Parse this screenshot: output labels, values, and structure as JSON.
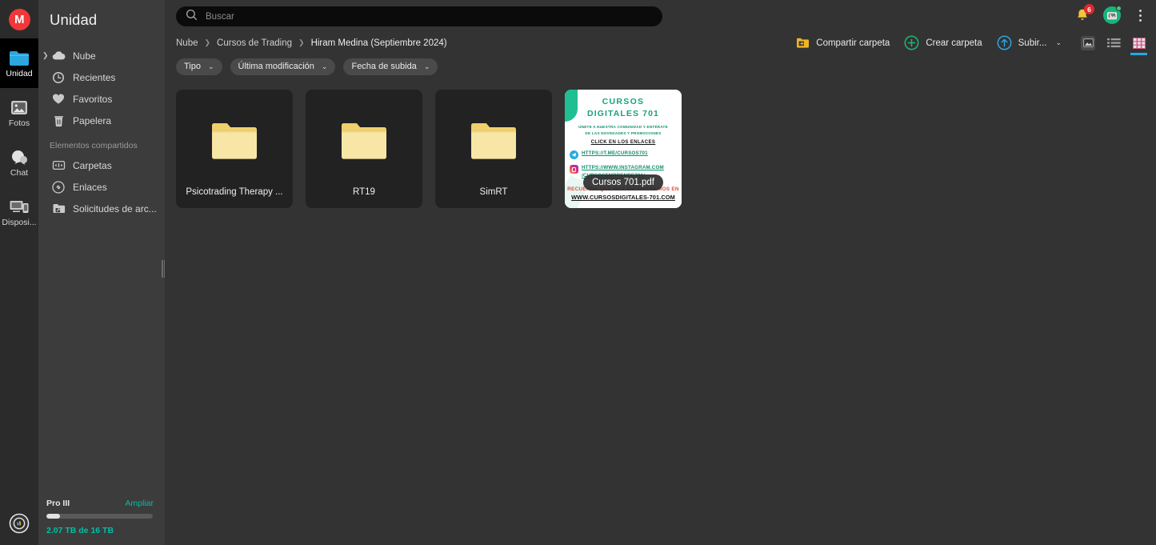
{
  "app": {
    "logo_text": "M"
  },
  "rail": {
    "items": [
      {
        "label": "Unidad",
        "icon": "drive-folder-icon",
        "active": true
      },
      {
        "label": "Fotos",
        "icon": "photos-icon",
        "active": false
      },
      {
        "label": "Chat",
        "icon": "chat-bubble-icon",
        "active": false
      },
      {
        "label": "Disposi...",
        "icon": "devices-icon",
        "active": false
      }
    ],
    "bottom_icon": "transfers-status-icon"
  },
  "sidebar": {
    "title": "Unidad",
    "nav": [
      {
        "label": "Nube",
        "icon": "cloud-icon",
        "expandable": true
      },
      {
        "label": "Recientes",
        "icon": "clock-icon",
        "expandable": false
      },
      {
        "label": "Favoritos",
        "icon": "heart-icon",
        "expandable": false
      },
      {
        "label": "Papelera",
        "icon": "trash-icon",
        "expandable": false
      }
    ],
    "shared_section": "Elementos compartidos",
    "shared": [
      {
        "label": "Carpetas",
        "icon": "shared-folders-icon"
      },
      {
        "label": "Enlaces",
        "icon": "link-icon"
      },
      {
        "label": "Solicitudes de arc...",
        "icon": "file-request-icon"
      }
    ],
    "storage": {
      "plan": "Pro III",
      "upgrade_label": "Ampliar",
      "used_text": "2.07 TB de 16 TB",
      "percent": 13,
      "accent_color": "#00bfa5"
    }
  },
  "topbar": {
    "search": {
      "placeholder": "Buscar",
      "value": "",
      "icon": "search-icon"
    },
    "notifications": {
      "icon": "bell-icon",
      "count": "6",
      "badge_color": "#e3272d"
    },
    "avatar": {
      "icon": "user-avatar-icon",
      "status": "online"
    },
    "menu_icon": "kebab-menu-icon"
  },
  "breadcrumb": {
    "items": [
      "Nube",
      "Cursos de Trading",
      "Hiram Medina (Septiembre 2024)"
    ],
    "separator": "❯"
  },
  "actions": {
    "share_folder": {
      "label": "Compartir carpeta",
      "icon": "share-folder-icon"
    },
    "create_folder": {
      "label": "Crear carpeta",
      "icon": "plus-circle-icon"
    },
    "upload": {
      "label": "Subir...",
      "icon": "upload-circle-icon",
      "caret": "⌄"
    },
    "views": [
      {
        "name": "media-view-icon",
        "active": false,
        "boxed": true
      },
      {
        "name": "list-view-icon",
        "active": false,
        "boxed": false
      },
      {
        "name": "grid-view-icon",
        "active": true,
        "boxed": false
      }
    ]
  },
  "filters": [
    {
      "label": "Tipo",
      "caret": "⌄"
    },
    {
      "label": "Última modificación",
      "caret": "⌄"
    },
    {
      "label": "Fecha de subida",
      "caret": "⌄"
    }
  ],
  "items": [
    {
      "name": "Psicotrading Therapy ...",
      "type": "folder"
    },
    {
      "name": "RT19",
      "type": "folder"
    },
    {
      "name": "SimRT",
      "type": "folder"
    },
    {
      "name": "Cursos 701.pdf",
      "type": "pdf"
    }
  ],
  "pdf_thumbnail": {
    "heading_line1": "CURSOS",
    "heading_line2": "DIGITALES 701",
    "para_line1": "ÚNETE A NUESTRA COMUNIDAD Y ENTÉRATE",
    "para_line2": "DE LAS NOVEDADES Y PROMOCIONES",
    "click_text": "CLICK EN LOS ENLACES",
    "telegram_link": "HTTPS://T.ME/CURSOS701",
    "instagram_link_1": "HTTPS://WWW.INSTAGRAM.COM",
    "instagram_link_2": "/CURSOSEMPRENDE701/",
    "bottom_line1": "RECUERDA QUE NOS ENCONTRAMOS EN",
    "bottom_line2": "WWW.CURSOSDIGITALES-701.COM",
    "brand_color": "#17a37d"
  }
}
